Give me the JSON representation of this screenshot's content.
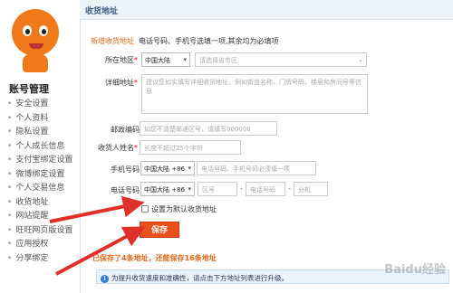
{
  "header": {
    "title": "收货地址"
  },
  "sidebar": {
    "title": "账号管理",
    "items": [
      "安全设置",
      "个人资料",
      "隐私设置",
      "个人成长信息",
      "支付宝绑定设置",
      "微博绑定设置",
      "个人交易信息",
      "收货地址",
      "网站提醒",
      "旺旺网页版设置",
      "应用授权",
      "分享绑定"
    ]
  },
  "form": {
    "new_address_label": "新增收货地址",
    "new_address_hint": "电话号码、手机号选填一项,其余均为必填项",
    "region_label": "所在地区",
    "region_value": "中国大陆",
    "region_placeholder": "请选择省市区",
    "detail_label": "详细地址",
    "detail_placeholder": "建议您如实填写详细收货地址，例如街道名称，门牌号码，楼层和房间号等信息",
    "postcode_label": "邮政编码",
    "postcode_placeholder": "如您不清楚邮递区号，请填写000000",
    "name_label": "收货人姓名",
    "name_placeholder": "长度不超过25个字符",
    "mobile_label": "手机号码",
    "mobile_country": "中国大陆 +86",
    "mobile_placeholder": "电话号码、手机号码必须填一项",
    "phone_label": "电话号码",
    "phone_country": "中国大陆 +86",
    "area_placeholder": "区号",
    "phone_placeholder": "电话号码",
    "ext_placeholder": "分机",
    "default_checkbox_label": "设置为默认收货地址",
    "save_label": "保存",
    "saved_warning": "已保存了4条地址，还能保存16条地址",
    "info_text": "为提升收货速度和准确性，请点击下方地址列表进行升级。",
    "info_icon": "i"
  },
  "watermark": "Baidu经验"
}
